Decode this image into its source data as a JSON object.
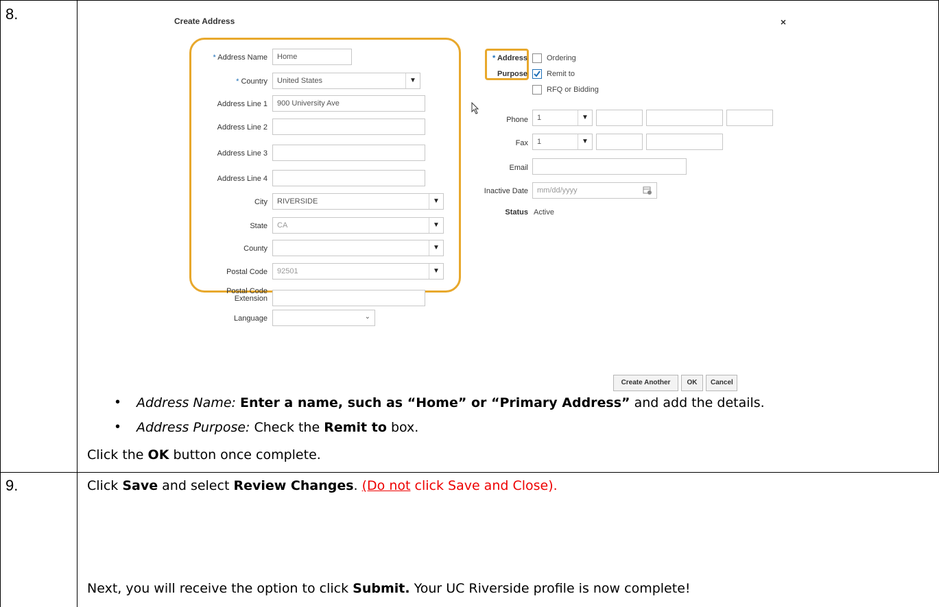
{
  "steps": [
    {
      "number": "8."
    },
    {
      "number": "9."
    }
  ],
  "dialog": {
    "title": "Create Address",
    "close_glyph": "×",
    "left_fields": {
      "address_name": {
        "label": "Address Name",
        "value": "Home"
      },
      "country": {
        "label": "Country",
        "value": "United States"
      },
      "address_line_1": {
        "label": "Address Line 1",
        "value": "900 University Ave"
      },
      "address_line_2": {
        "label": "Address Line 2",
        "value": ""
      },
      "address_line_3": {
        "label": "Address Line 3",
        "value": ""
      },
      "address_line_4": {
        "label": "Address Line 4",
        "value": ""
      },
      "city": {
        "label": "City",
        "value": "RIVERSIDE"
      },
      "state": {
        "label": "State",
        "value": "CA"
      },
      "county": {
        "label": "County",
        "value": ""
      },
      "postal_code": {
        "label": "Postal Code",
        "value": "92501"
      },
      "postal_code_extension": {
        "label_line1": "Postal Code",
        "label_line2": "Extension",
        "value": ""
      },
      "language": {
        "label": "Language",
        "value": ""
      }
    },
    "purpose": {
      "label_line1": "Address",
      "label_line2": "Purpose",
      "options": [
        {
          "label": "Ordering",
          "checked": false
        },
        {
          "label": "Remit to",
          "checked": true
        },
        {
          "label": "RFQ or Bidding",
          "checked": false
        }
      ]
    },
    "phone": {
      "label": "Phone",
      "country_code": "1"
    },
    "fax": {
      "label": "Fax",
      "country_code": "1"
    },
    "email": {
      "label": "Email",
      "value": ""
    },
    "inactive_date": {
      "label": "Inactive Date",
      "placeholder": "mm/dd/yyyy"
    },
    "status": {
      "label": "Status",
      "value": "Active"
    },
    "buttons": {
      "create_another": "Create Another",
      "ok": "OK",
      "cancel": "Cancel"
    }
  },
  "instructions": {
    "bullet1": {
      "italic": "Address Name:",
      "bold": "Enter a name, such as “Home” or “Primary Address”",
      "rest": "and add the details."
    },
    "bullet2": {
      "italic": "Address Purpose:",
      "pre": "Check the",
      "bold": "Remit to",
      "rest": "box."
    },
    "click_ok": {
      "pre": "Click the",
      "bold": "OK",
      "rest": "button once complete."
    },
    "step9_line1": {
      "pre": "Click",
      "bold1": "Save",
      "mid": "and select",
      "bold2": "Review Changes",
      "dot": ".",
      "red_underline": "(Do not",
      "red_rest": "click Save and Close)."
    },
    "step9_line2": {
      "pre": "Next, you will receive the option to click",
      "bold": "Submit.",
      "rest": "Your UC Riverside profile is now complete!"
    }
  },
  "colors": {
    "highlight": "#e8a82c",
    "required": "#1d6fb8",
    "warning": "#ee0000"
  }
}
